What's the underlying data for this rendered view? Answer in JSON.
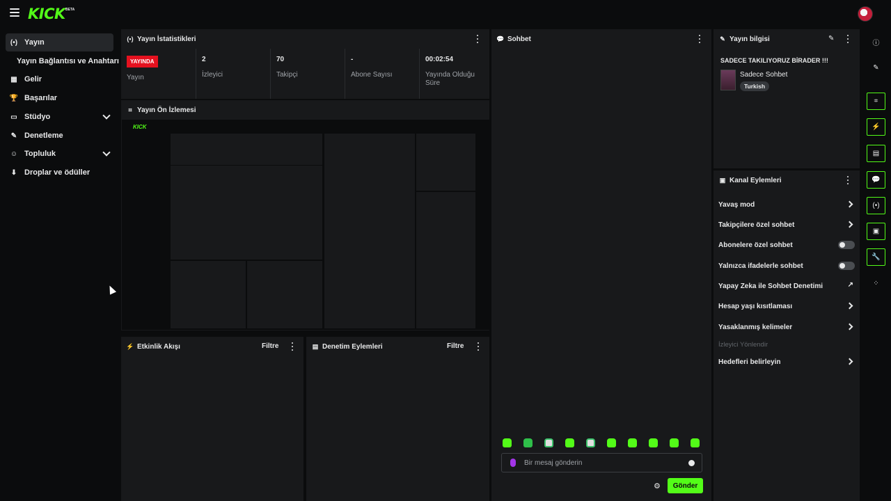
{
  "app": {
    "logo": "KICK",
    "logo_badge": "BETA"
  },
  "sidebar": {
    "items": [
      {
        "icon": "broadcast-icon",
        "glyph": "(•)",
        "label": "Yayın"
      },
      {
        "icon": "none",
        "glyph": "",
        "label": "Yayın Bağlantısı ve Anahtarı"
      },
      {
        "icon": "revenue-icon",
        "glyph": "▦",
        "label": "Gelir"
      },
      {
        "icon": "trophy-icon",
        "glyph": "🏆",
        "label": "Başarılar"
      },
      {
        "icon": "studio-icon",
        "glyph": "▭",
        "label": "Stüdyo"
      },
      {
        "icon": "wrench-icon",
        "glyph": "✎",
        "label": "Denetleme"
      },
      {
        "icon": "community-icon",
        "glyph": "☺",
        "label": "Topluluk"
      },
      {
        "icon": "drops-icon",
        "glyph": "⬇",
        "label": "Droplar ve ödüller"
      }
    ]
  },
  "stats_panel": {
    "title": "Yayın İstatistikleri",
    "badge": "YAYINDA",
    "cells": [
      {
        "value": "YAYINDA",
        "label": "Yayın"
      },
      {
        "value": "2",
        "label": "İzleyici"
      },
      {
        "value": "70",
        "label": "Takipçi"
      },
      {
        "value": "-",
        "label": "Abone Sayısı"
      },
      {
        "value": "00:02:54",
        "label": "Yayında Olduğu Süre"
      }
    ]
  },
  "preview_panel": {
    "title": "Yayın Ön İzlemesi"
  },
  "activity_panel": {
    "title": "Etkinlik Akışı",
    "filter": "Filtre"
  },
  "moderation_panel": {
    "title": "Denetim Eylemleri",
    "filter": "Filtre"
  },
  "chat_panel": {
    "title": "Sohbet",
    "input_placeholder": "Bir mesaj gönderin",
    "send_label": "Gönder",
    "emote_count": 10
  },
  "stream_info_panel": {
    "title": "Yayın bilgisi",
    "stream_title": "SADECE TAKILIYORUZ BİRADER !!!",
    "category": "Sadece Sohbet",
    "language": "Turkish"
  },
  "channel_actions_panel": {
    "title": "Kanal Eylemleri",
    "actions": [
      {
        "label": "Yavaş mod",
        "control": "arrow"
      },
      {
        "label": "Takipçilere özel sohbet",
        "control": "arrow"
      },
      {
        "label": "Abonelere özel sohbet",
        "control": "toggle",
        "on": false
      },
      {
        "label": "Yalnızca ifadelerle sohbet",
        "control": "toggle",
        "on": false
      },
      {
        "label": "Yapay Zeka ile Sohbet Denetimi",
        "control": "trend"
      },
      {
        "label": "Hesap yaşı kısıtlaması",
        "control": "arrow"
      },
      {
        "label": "Yasaklanmış kelimeler",
        "control": "arrow"
      },
      {
        "label": "İzleyici Yönlendir",
        "control": "none",
        "disabled": true
      },
      {
        "label": "Hedefleri belirleyin",
        "control": "arrow"
      }
    ]
  },
  "rail": {
    "buttons": [
      {
        "name": "info-icon",
        "glyph": "ⓘ",
        "boxed": false
      },
      {
        "name": "pencil-icon",
        "glyph": "✎",
        "boxed": false
      },
      {
        "name": "focus-icon",
        "glyph": "⌗",
        "boxed": true
      },
      {
        "name": "bolt-icon",
        "glyph": "⚡",
        "boxed": true
      },
      {
        "name": "document-icon",
        "glyph": "▤",
        "boxed": true
      },
      {
        "name": "chat-bubble-icon",
        "glyph": "💬",
        "boxed": true
      },
      {
        "name": "broadcast-icon",
        "glyph": "(•)",
        "boxed": true
      },
      {
        "name": "panel-icon",
        "glyph": "▣",
        "boxed": true
      },
      {
        "name": "wrench-icon",
        "glyph": "🔧",
        "boxed": true
      },
      {
        "name": "community-icon",
        "glyph": "⁘",
        "boxed": false
      }
    ]
  },
  "colors": {
    "accent": "#53fc18",
    "live": "#e5111f",
    "panel": "#18191b",
    "background": "#0b0c0d"
  }
}
